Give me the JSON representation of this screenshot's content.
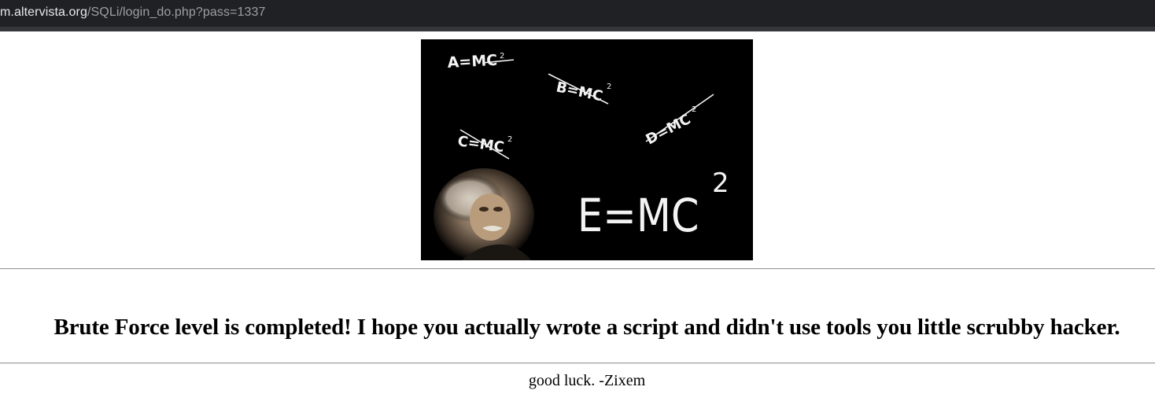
{
  "browser": {
    "url_domain": "m.altervista.org",
    "url_path": "/SQLi/login_do.php?pass=1337"
  },
  "image": {
    "equations": {
      "a": "A=MC",
      "b": "B=MC",
      "c": "C=MC",
      "d": "D=MC",
      "e": "E=MC",
      "sup": "2"
    }
  },
  "content": {
    "headline": "Brute Force level is completed! I hope you actually wrote a script and didn't use tools you little scrubby hacker.",
    "footer": "good luck. -Zixem"
  }
}
